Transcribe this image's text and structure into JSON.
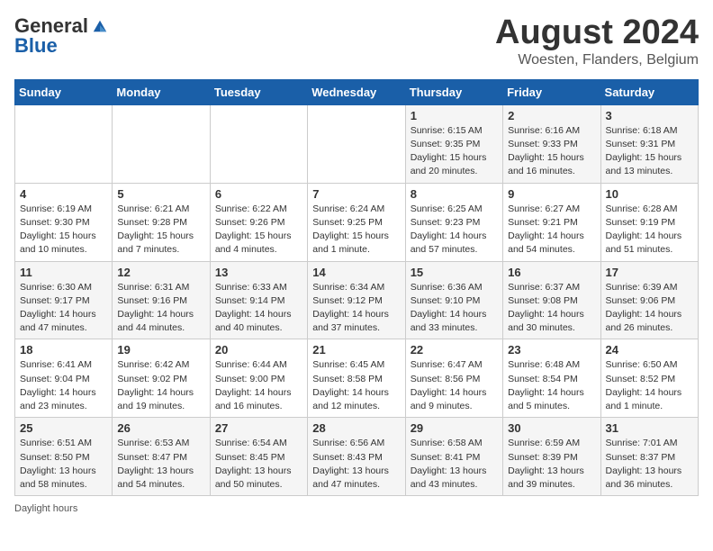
{
  "header": {
    "logo_general": "General",
    "logo_blue": "Blue",
    "month_title": "August 2024",
    "location": "Woesten, Flanders, Belgium"
  },
  "days_of_week": [
    "Sunday",
    "Monday",
    "Tuesday",
    "Wednesday",
    "Thursday",
    "Friday",
    "Saturday"
  ],
  "weeks": [
    [
      {
        "num": "",
        "info": ""
      },
      {
        "num": "",
        "info": ""
      },
      {
        "num": "",
        "info": ""
      },
      {
        "num": "",
        "info": ""
      },
      {
        "num": "1",
        "info": "Sunrise: 6:15 AM\nSunset: 9:35 PM\nDaylight: 15 hours\nand 20 minutes."
      },
      {
        "num": "2",
        "info": "Sunrise: 6:16 AM\nSunset: 9:33 PM\nDaylight: 15 hours\nand 16 minutes."
      },
      {
        "num": "3",
        "info": "Sunrise: 6:18 AM\nSunset: 9:31 PM\nDaylight: 15 hours\nand 13 minutes."
      }
    ],
    [
      {
        "num": "4",
        "info": "Sunrise: 6:19 AM\nSunset: 9:30 PM\nDaylight: 15 hours\nand 10 minutes."
      },
      {
        "num": "5",
        "info": "Sunrise: 6:21 AM\nSunset: 9:28 PM\nDaylight: 15 hours\nand 7 minutes."
      },
      {
        "num": "6",
        "info": "Sunrise: 6:22 AM\nSunset: 9:26 PM\nDaylight: 15 hours\nand 4 minutes."
      },
      {
        "num": "7",
        "info": "Sunrise: 6:24 AM\nSunset: 9:25 PM\nDaylight: 15 hours\nand 1 minute."
      },
      {
        "num": "8",
        "info": "Sunrise: 6:25 AM\nSunset: 9:23 PM\nDaylight: 14 hours\nand 57 minutes."
      },
      {
        "num": "9",
        "info": "Sunrise: 6:27 AM\nSunset: 9:21 PM\nDaylight: 14 hours\nand 54 minutes."
      },
      {
        "num": "10",
        "info": "Sunrise: 6:28 AM\nSunset: 9:19 PM\nDaylight: 14 hours\nand 51 minutes."
      }
    ],
    [
      {
        "num": "11",
        "info": "Sunrise: 6:30 AM\nSunset: 9:17 PM\nDaylight: 14 hours\nand 47 minutes."
      },
      {
        "num": "12",
        "info": "Sunrise: 6:31 AM\nSunset: 9:16 PM\nDaylight: 14 hours\nand 44 minutes."
      },
      {
        "num": "13",
        "info": "Sunrise: 6:33 AM\nSunset: 9:14 PM\nDaylight: 14 hours\nand 40 minutes."
      },
      {
        "num": "14",
        "info": "Sunrise: 6:34 AM\nSunset: 9:12 PM\nDaylight: 14 hours\nand 37 minutes."
      },
      {
        "num": "15",
        "info": "Sunrise: 6:36 AM\nSunset: 9:10 PM\nDaylight: 14 hours\nand 33 minutes."
      },
      {
        "num": "16",
        "info": "Sunrise: 6:37 AM\nSunset: 9:08 PM\nDaylight: 14 hours\nand 30 minutes."
      },
      {
        "num": "17",
        "info": "Sunrise: 6:39 AM\nSunset: 9:06 PM\nDaylight: 14 hours\nand 26 minutes."
      }
    ],
    [
      {
        "num": "18",
        "info": "Sunrise: 6:41 AM\nSunset: 9:04 PM\nDaylight: 14 hours\nand 23 minutes."
      },
      {
        "num": "19",
        "info": "Sunrise: 6:42 AM\nSunset: 9:02 PM\nDaylight: 14 hours\nand 19 minutes."
      },
      {
        "num": "20",
        "info": "Sunrise: 6:44 AM\nSunset: 9:00 PM\nDaylight: 14 hours\nand 16 minutes."
      },
      {
        "num": "21",
        "info": "Sunrise: 6:45 AM\nSunset: 8:58 PM\nDaylight: 14 hours\nand 12 minutes."
      },
      {
        "num": "22",
        "info": "Sunrise: 6:47 AM\nSunset: 8:56 PM\nDaylight: 14 hours\nand 9 minutes."
      },
      {
        "num": "23",
        "info": "Sunrise: 6:48 AM\nSunset: 8:54 PM\nDaylight: 14 hours\nand 5 minutes."
      },
      {
        "num": "24",
        "info": "Sunrise: 6:50 AM\nSunset: 8:52 PM\nDaylight: 14 hours\nand 1 minute."
      }
    ],
    [
      {
        "num": "25",
        "info": "Sunrise: 6:51 AM\nSunset: 8:50 PM\nDaylight: 13 hours\nand 58 minutes."
      },
      {
        "num": "26",
        "info": "Sunrise: 6:53 AM\nSunset: 8:47 PM\nDaylight: 13 hours\nand 54 minutes."
      },
      {
        "num": "27",
        "info": "Sunrise: 6:54 AM\nSunset: 8:45 PM\nDaylight: 13 hours\nand 50 minutes."
      },
      {
        "num": "28",
        "info": "Sunrise: 6:56 AM\nSunset: 8:43 PM\nDaylight: 13 hours\nand 47 minutes."
      },
      {
        "num": "29",
        "info": "Sunrise: 6:58 AM\nSunset: 8:41 PM\nDaylight: 13 hours\nand 43 minutes."
      },
      {
        "num": "30",
        "info": "Sunrise: 6:59 AM\nSunset: 8:39 PM\nDaylight: 13 hours\nand 39 minutes."
      },
      {
        "num": "31",
        "info": "Sunrise: 7:01 AM\nSunset: 8:37 PM\nDaylight: 13 hours\nand 36 minutes."
      }
    ]
  ],
  "footer": {
    "daylight_label": "Daylight hours"
  }
}
